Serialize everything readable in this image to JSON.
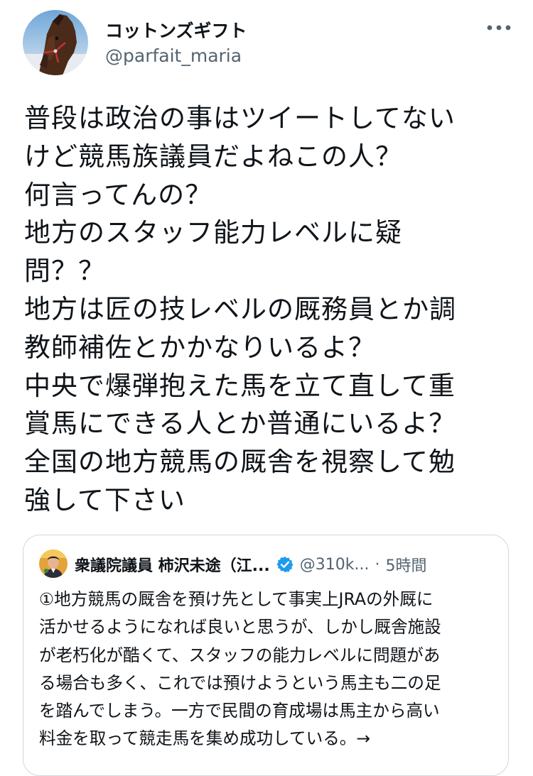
{
  "author": {
    "display_name": "コットンズギフト",
    "handle": "@parfait_maria"
  },
  "tweet": {
    "lines": [
      "普段は政治の事はツイートしてない",
      "けど競馬族議員だよねこの人？",
      "何言ってんの？",
      "地方のスタッフ能力レベルに疑",
      "問？？",
      "地方は匠の技レベルの厩務員とか調",
      "教師補佐とかかなりいるよ？",
      "中央で爆弾抱えた馬を立て直して重",
      "賞馬にできる人とか普通にいるよ？",
      "全国の地方競馬の厩舎を視察して勉",
      "強して下さい"
    ]
  },
  "quote": {
    "display_name": "衆議院議員 柿沢未途（江...",
    "handle": "@310k...",
    "separator": "·",
    "time": "5時間",
    "lines": [
      "①地方競馬の厩舎を預け先として事実上JRAの外厩に",
      "活かせるようになれば良いと思うが、しかし厩舎施設",
      "が老朽化が酷くて、スタッフの能力レベルに問題があ",
      "る場合も多く、これでは預けようという馬主も二の足",
      "を踏んでしまう。一方で民間の育成場は馬主から高い",
      "料金を取って競走馬を集め成功している。→"
    ]
  },
  "icons": {
    "more": "more-horizontal-icon",
    "verified": "verified-badge-icon"
  },
  "colors": {
    "text": "#0f1419",
    "secondary": "#536471",
    "border": "#cfd9de",
    "verified": "#1d9bf0"
  }
}
